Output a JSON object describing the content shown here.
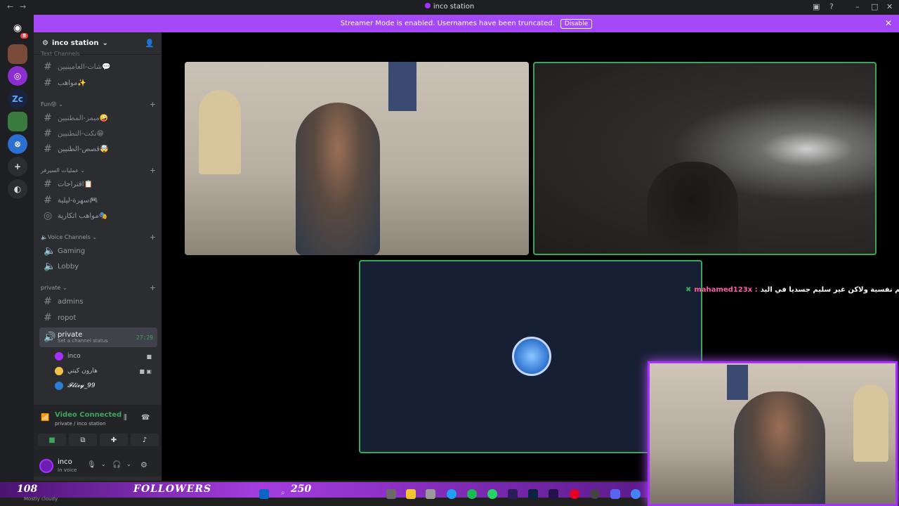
{
  "window": {
    "title": "inco station"
  },
  "banner": {
    "text": "Streamer Mode is enabled. Usernames have been truncated.",
    "button": "Disable"
  },
  "servers": {
    "badge": "8",
    "zc_label": "Zc"
  },
  "guild": {
    "name": "inco station"
  },
  "channels": {
    "top_cut": "Text Channels",
    "items_top": [
      {
        "name": "شات-العامينيين💬"
      },
      {
        "name": "مواهب✨"
      }
    ],
    "fun_category": "Fun😝",
    "fun_items": [
      {
        "name": "ميمز-المطنيين🤪"
      },
      {
        "name": "نكت-النطنيين😁"
      },
      {
        "name": "قصص-الطنيين🤯"
      }
    ],
    "server_category": "عمليات السيرفر",
    "server_items": [
      {
        "name": "اقتراحات📋"
      },
      {
        "name": "سهرة-ليلية🎮"
      },
      {
        "name": "مواهب اتكارية🎭"
      }
    ],
    "voice_category": "Voice Channels",
    "voice_items": [
      {
        "name": "Gaming"
      },
      {
        "name": "Lobby"
      }
    ],
    "private_category": "private",
    "private_items": [
      {
        "name": "admins"
      },
      {
        "name": "ropot"
      }
    ],
    "active_voice": {
      "name": "private",
      "status": "Set a channel status",
      "timer": "27:29"
    },
    "voice_users": [
      {
        "name": "inco",
        "color": "#a530ff"
      },
      {
        "name": "هارون كيتي",
        "color": "#f0c24b"
      },
      {
        "name": "𝓕𝓵𝓲𝔁𝔂_99",
        "color": "#2b7cd3"
      }
    ]
  },
  "voice_panel": {
    "status": "Video Connected",
    "location": "private / inco station"
  },
  "user_panel": {
    "username": "inco",
    "status": "In voice"
  },
  "stage": {
    "chat_username": "mahamed123x :",
    "chat_message": "انا سليم نفسية ولاكن غير سليم جسديا في اليد"
  },
  "overlay": {
    "left_number": "108",
    "label": "FOLLOWERS",
    "right_number": "250"
  },
  "taskbar": {
    "status_text": "Mostly cloudy"
  }
}
